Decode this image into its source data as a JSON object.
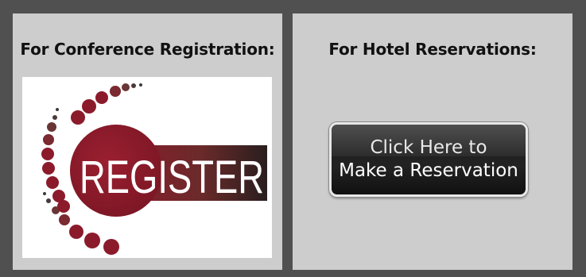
{
  "left_panel": {
    "heading": "For Conference Registration:",
    "button_text": "REGISTER"
  },
  "right_panel": {
    "heading": "For Hotel Reservations:",
    "button_line1": "Click Here to",
    "button_line2": "Make a Reservation"
  },
  "colors": {
    "outer_background": "#505050",
    "panel_background": "#cdcdcd",
    "register_maroon": "#8a1a2a",
    "button_black": "#1e1e1e"
  }
}
